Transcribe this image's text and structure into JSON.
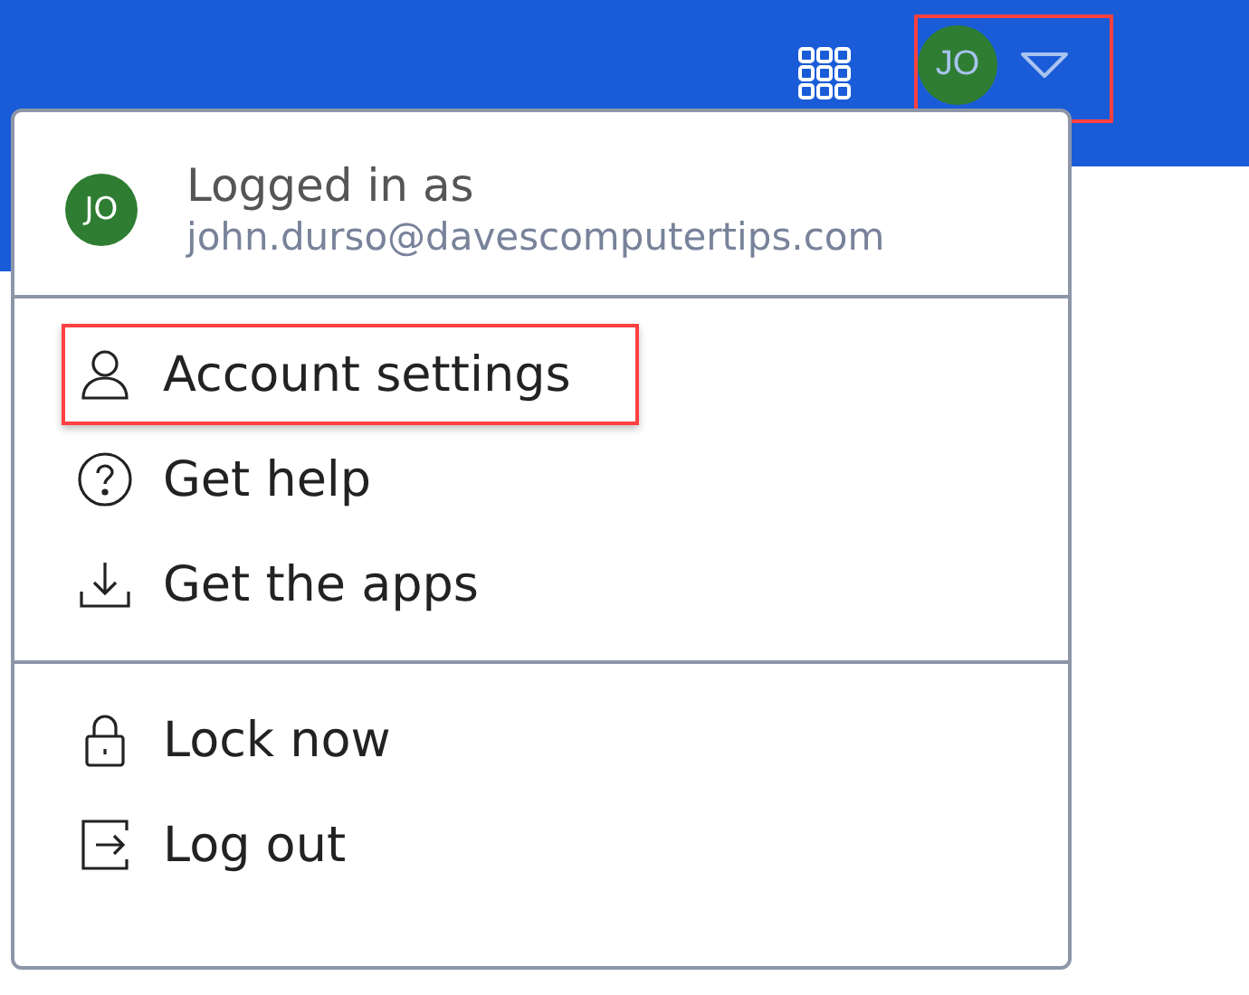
{
  "top_bar": {
    "avatar_initials": "JO",
    "account_highlighted": true
  },
  "account_menu": {
    "avatar_initials": "JO",
    "caption": "Logged in as",
    "email": "john.durso@davescomputertips.com",
    "sections": [
      {
        "items": [
          {
            "kind": "person",
            "label": "Account settings",
            "highlighted": true
          },
          {
            "kind": "help",
            "label": "Get help",
            "highlighted": false
          },
          {
            "kind": "download",
            "label": "Get the apps",
            "highlighted": false
          }
        ]
      },
      {
        "items": [
          {
            "kind": "lock",
            "label": "Lock now",
            "highlighted": false
          },
          {
            "kind": "logout",
            "label": "Log out",
            "highlighted": false
          }
        ]
      }
    ]
  }
}
